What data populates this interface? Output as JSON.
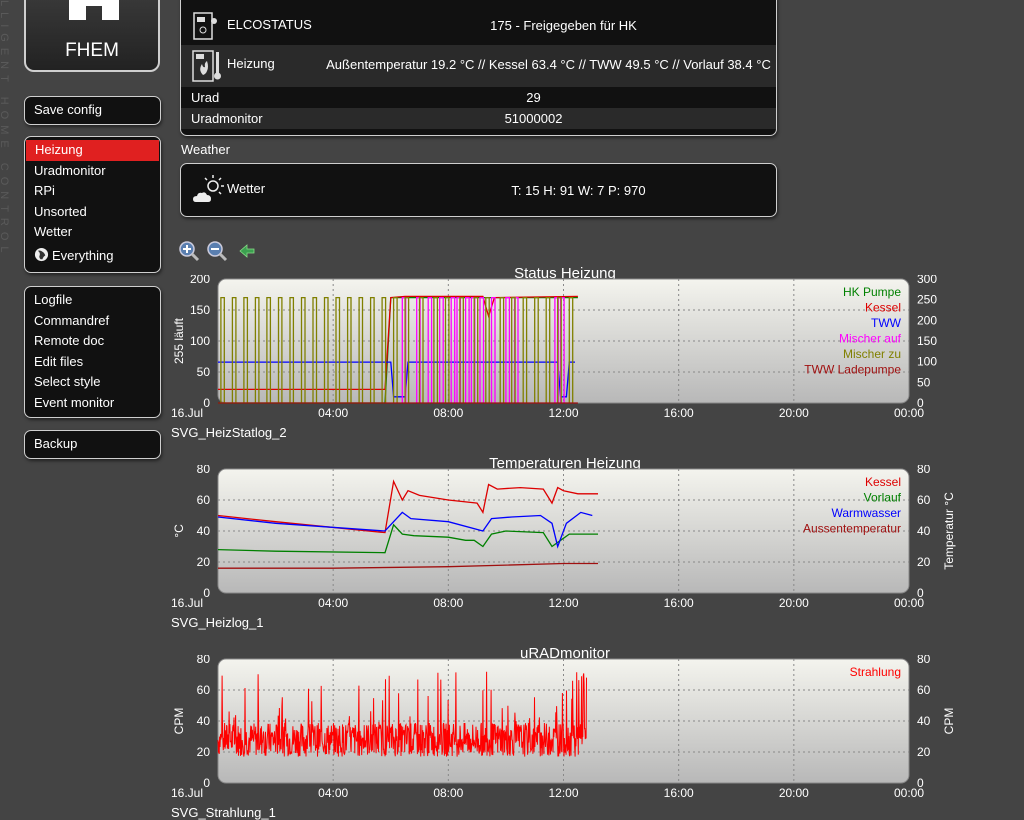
{
  "sidebar_vertical_text": "LLIGENT HOME CONTROL",
  "logo": {
    "brand": "FHEM"
  },
  "menu_top": [
    {
      "label": "Save config"
    }
  ],
  "menu_rooms": [
    {
      "label": "Heizung",
      "active": true
    },
    {
      "label": "Uradmonitor"
    },
    {
      "label": "RPi"
    },
    {
      "label": "Unsorted"
    },
    {
      "label": "Wetter"
    },
    {
      "label": "Everything"
    }
  ],
  "menu_tools": [
    {
      "label": "Logfile"
    },
    {
      "label": "Commandref"
    },
    {
      "label": "Remote doc"
    },
    {
      "label": "Edit files"
    },
    {
      "label": "Select style"
    },
    {
      "label": "Event monitor"
    }
  ],
  "menu_bottom": [
    {
      "label": "Backup"
    }
  ],
  "devices": {
    "elcostatus": {
      "name": "ELCOSTATUS",
      "value": "175 - Freigegeben für HK",
      "icon": "boiler-status-icon"
    },
    "heizung": {
      "name": "Heizung",
      "value": "Außentemperatur 19.2 °C // Kessel 63.4 °C // TWW 49.5 °C // Vorlauf 38.4 °C",
      "icon": "heating-icon"
    },
    "urad": {
      "name": "Urad",
      "value": "29"
    },
    "uradmonitor": {
      "name": "Uradmonitor",
      "value": "51000002"
    }
  },
  "weather_section": "Weather",
  "weather": {
    "name": "Wetter",
    "value": "T: 15 H: 91 W: 7 P: 970",
    "icon": "weather-sun-cloud-icon"
  },
  "zoom_icons": [
    "zoom-in-icon",
    "zoom-out-icon",
    "back-arrow-icon"
  ],
  "colors": {
    "active": "#e02020",
    "panel": "#111111",
    "background": "#444444"
  },
  "chart_data": [
    {
      "type": "line",
      "name": "SVG_HeizStatlog_2",
      "title": "Status Heizung",
      "ylabel": "255 läuft",
      "y2label": "",
      "ylim": [
        0,
        200
      ],
      "y2lim": [
        0,
        300
      ],
      "yticks": [
        0,
        50,
        100,
        150,
        200
      ],
      "y2ticks": [
        0,
        50,
        100,
        150,
        200,
        250,
        300
      ],
      "xlim": [
        0,
        24
      ],
      "xticks": [
        {
          "x": 0,
          "label": "16.Jul"
        },
        {
          "x": 4,
          "label": "04:00"
        },
        {
          "x": 8,
          "label": "08:00"
        },
        {
          "x": 12,
          "label": "12:00"
        },
        {
          "x": 16,
          "label": "16:00"
        },
        {
          "x": 20,
          "label": "20:00"
        },
        {
          "x": 24,
          "label": "00:00"
        }
      ],
      "legend": "top-right",
      "series": [
        {
          "name": "HK Pumpe",
          "color": "#008000",
          "points": [
            [
              0,
              0
            ],
            [
              5.8,
              0
            ],
            [
              6,
              170
            ],
            [
              12.5,
              170
            ]
          ]
        },
        {
          "name": "Kessel",
          "color": "#dd0000",
          "points": [
            [
              0,
              22
            ],
            [
              5.8,
              22
            ],
            [
              6,
              170
            ],
            [
              6.5,
              172
            ],
            [
              9.2,
              172
            ],
            [
              9.4,
              140
            ],
            [
              9.6,
              170
            ],
            [
              12.5,
              172
            ]
          ]
        },
        {
          "name": "TWW",
          "color": "#0000ff",
          "points": [
            [
              0,
              66
            ],
            [
              5.8,
              66
            ],
            [
              6,
              66
            ],
            [
              6.1,
              10
            ],
            [
              6.5,
              10
            ],
            [
              6.6,
              66
            ],
            [
              11.8,
              66
            ],
            [
              11.9,
              10
            ],
            [
              12.1,
              10
            ],
            [
              12.2,
              66
            ],
            [
              12.4,
              66
            ]
          ]
        },
        {
          "name": "Mischer auf",
          "color": "#ff00ff",
          "pulses": [
            6.4,
            6.9,
            7.3,
            7.7,
            8.1,
            8.3,
            8.6,
            8.8,
            9.1,
            9.5,
            10.0,
            10.3,
            11.7,
            11.9
          ],
          "high": 170
        },
        {
          "name": "Mischer zu",
          "color": "#808000",
          "pulses": [
            0.1,
            0.5,
            0.9,
            1.3,
            1.7,
            2.1,
            2.5,
            2.9,
            3.3,
            3.7,
            4.1,
            4.5,
            4.9,
            5.3,
            5.7,
            6.1,
            6.5,
            7.0,
            7.5,
            7.9,
            8.4,
            8.9,
            9.3,
            9.8,
            10.2,
            10.6,
            11.0,
            11.4,
            11.8,
            12.2
          ],
          "high": 170
        },
        {
          "name": "TWW Ladepumpe",
          "color": "#a01010",
          "points": [
            [
              0,
              0
            ],
            [
              12.5,
              0
            ]
          ]
        }
      ]
    },
    {
      "type": "line",
      "name": "SVG_Heizlog_1",
      "title": "Temperaturen Heizung",
      "ylabel": "°C",
      "y2label": "Temperatur °C",
      "ylim": [
        0,
        80
      ],
      "y2lim": [
        0,
        80
      ],
      "yticks": [
        0,
        20,
        40,
        60,
        80
      ],
      "y2ticks": [
        0,
        20,
        40,
        60,
        80
      ],
      "xlim": [
        0,
        24
      ],
      "xticks": [
        {
          "x": 0,
          "label": "16.Jul"
        },
        {
          "x": 4,
          "label": "04:00"
        },
        {
          "x": 8,
          "label": "08:00"
        },
        {
          "x": 12,
          "label": "12:00"
        },
        {
          "x": 16,
          "label": "16:00"
        },
        {
          "x": 20,
          "label": "20:00"
        },
        {
          "x": 24,
          "label": "00:00"
        }
      ],
      "legend": "top-right",
      "series": [
        {
          "name": "Kessel",
          "color": "#dd0000",
          "points": [
            [
              0,
              50
            ],
            [
              2,
              46
            ],
            [
              5.8,
              39
            ],
            [
              6.1,
              72
            ],
            [
              6.4,
              60
            ],
            [
              6.6,
              66
            ],
            [
              7,
              63
            ],
            [
              8,
              60
            ],
            [
              9,
              58
            ],
            [
              9.2,
              52
            ],
            [
              9.4,
              70
            ],
            [
              9.7,
              67
            ],
            [
              10.5,
              68
            ],
            [
              11.3,
              67
            ],
            [
              11.6,
              58
            ],
            [
              11.8,
              68
            ],
            [
              12,
              66
            ],
            [
              12.5,
              64
            ],
            [
              13.2,
              64
            ]
          ]
        },
        {
          "name": "Vorlauf",
          "color": "#008000",
          "points": [
            [
              0,
              28
            ],
            [
              2,
              27
            ],
            [
              5.8,
              26
            ],
            [
              6.1,
              44
            ],
            [
              6.4,
              38
            ],
            [
              6.8,
              37
            ],
            [
              8,
              36
            ],
            [
              8.6,
              34
            ],
            [
              8.9,
              34
            ],
            [
              9.2,
              30
            ],
            [
              9.5,
              38
            ],
            [
              10,
              40
            ],
            [
              11.3,
              39
            ],
            [
              11.6,
              30
            ],
            [
              11.9,
              34
            ],
            [
              12.2,
              38
            ],
            [
              12.6,
              38
            ],
            [
              13.2,
              38
            ]
          ]
        },
        {
          "name": "Warmwasser",
          "color": "#0000ff",
          "points": [
            [
              0,
              49
            ],
            [
              2,
              45
            ],
            [
              5.8,
              40
            ],
            [
              6.1,
              46
            ],
            [
              6.4,
              52
            ],
            [
              6.7,
              48
            ],
            [
              8,
              46
            ],
            [
              9.2,
              40
            ],
            [
              9.5,
              48
            ],
            [
              10.2,
              49
            ],
            [
              11.2,
              50
            ],
            [
              11.6,
              45
            ],
            [
              11.8,
              30
            ],
            [
              12.1,
              45
            ],
            [
              12.6,
              52
            ],
            [
              13,
              50
            ]
          ]
        },
        {
          "name": "Aussentemperatur",
          "color": "#a01010",
          "points": [
            [
              0,
              16
            ],
            [
              4,
              16
            ],
            [
              8,
              17
            ],
            [
              10,
              18
            ],
            [
              12,
              19
            ],
            [
              13.2,
              19
            ]
          ]
        }
      ]
    },
    {
      "type": "line",
      "name": "SVG_Strahlung_1",
      "title": "uRADmonitor",
      "ylabel": "CPM",
      "y2label": "CPM",
      "ylim": [
        0,
        80
      ],
      "y2lim": [
        0,
        80
      ],
      "yticks": [
        0,
        20,
        40,
        60,
        80
      ],
      "y2ticks": [
        0,
        20,
        40,
        60,
        80
      ],
      "xlim": [
        0,
        24
      ],
      "xticks": [
        {
          "x": 0,
          "label": "16.Jul"
        },
        {
          "x": 4,
          "label": "04:00"
        },
        {
          "x": 8,
          "label": "08:00"
        },
        {
          "x": 12,
          "label": "12:00"
        },
        {
          "x": 16,
          "label": "16:00"
        },
        {
          "x": 20,
          "label": "20:00"
        },
        {
          "x": 24,
          "label": "00:00"
        }
      ],
      "legend": "top-right",
      "series": [
        {
          "name": "Strahlung",
          "color": "#ff0000",
          "noise": {
            "from": 0,
            "to": 12.8,
            "mean": 28,
            "min": 10,
            "max": 72
          }
        }
      ]
    }
  ]
}
